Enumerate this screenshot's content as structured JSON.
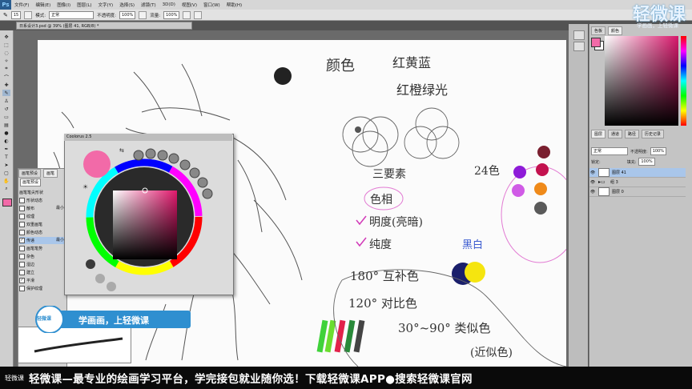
{
  "menubar": {
    "logo": "Ps",
    "items": [
      "文件(F)",
      "编辑(E)",
      "图像(I)",
      "图层(L)",
      "文字(Y)",
      "选择(S)",
      "滤镜(T)",
      "3D(D)",
      "视图(V)",
      "窗口(W)",
      "帮助(H)"
    ]
  },
  "options": {
    "brush_size": "15",
    "mode_label": "模式:",
    "mode_value": "正常",
    "opacity_label": "不透明度:",
    "opacity_value": "100%",
    "flow_label": "流量:",
    "flow_value": "100%"
  },
  "document": {
    "tab_title": "日系设计3.psd @ 39% (图层 41, RGB/8) *"
  },
  "layers": {
    "blend_mode": "正常",
    "opacity_label": "不透明度:",
    "opacity_value": "100%",
    "fill_label": "填充:",
    "fill_value": "100%",
    "lock_label": "锁定:",
    "rows": [
      {
        "name": "图层 41",
        "selected": true
      },
      {
        "name": "组 3",
        "selected": false
      },
      {
        "name": "图层 0",
        "selected": false
      }
    ],
    "tabs": [
      "图层",
      "通道",
      "路径",
      "历史记录"
    ]
  },
  "color_panel": {
    "tabs": [
      "色板",
      "颜色"
    ],
    "foreground": "#f26aa8",
    "background": "#ffffff"
  },
  "brush_panel": {
    "tabs": [
      "画笔预设",
      "画笔"
    ],
    "preset_button": "画笔预设",
    "options": [
      {
        "label": "画笔笔尖形状",
        "checked": false
      },
      {
        "label": "形状动态",
        "checked": false
      },
      {
        "label": "散布",
        "checked": false
      },
      {
        "label": "纹理",
        "checked": false
      },
      {
        "label": "双重画笔",
        "checked": false
      },
      {
        "label": "颜色动态",
        "checked": false
      },
      {
        "label": "传递",
        "checked": true
      },
      {
        "label": "画笔笔势",
        "checked": false
      },
      {
        "label": "杂色",
        "checked": false
      },
      {
        "label": "湿边",
        "checked": false
      },
      {
        "label": "建立",
        "checked": false
      },
      {
        "label": "平滑",
        "checked": true
      },
      {
        "label": "保护纹理",
        "checked": false
      }
    ],
    "side_label_1": "最小",
    "side_label_2": "最小"
  },
  "coolorus": {
    "title": "Coolorus 2.5",
    "current_color": "#f26aa8"
  },
  "canvas_notes": {
    "n1": "颜色",
    "n2": "红黄蓝",
    "n3": "红橙绿光",
    "n4": "三要素",
    "n5": "色相",
    "n6": "明度(亮暗)",
    "n7": "纯度",
    "n8": "180°  互补色",
    "n9": "120°  对比色",
    "n10": "30°~90°  类似色",
    "n11": "(近似色)",
    "n12": "24色",
    "n13": "黑白"
  },
  "watermark": {
    "top": "轻微课",
    "top_sub": "学画画，上轻微课",
    "badge_logo": "轻微课",
    "badge_text": "学画画，上轻微课"
  },
  "banner": {
    "logo": "轻微课",
    "text": "轻微课—最专业的绘画学习平台，学完接包就业随你选！下载轻微课APP●搜索轻微课官网"
  },
  "colors": {
    "accent_pink": "#f26aa8",
    "ps_bg": "#535353",
    "badge_blue": "#2f8fd0"
  }
}
